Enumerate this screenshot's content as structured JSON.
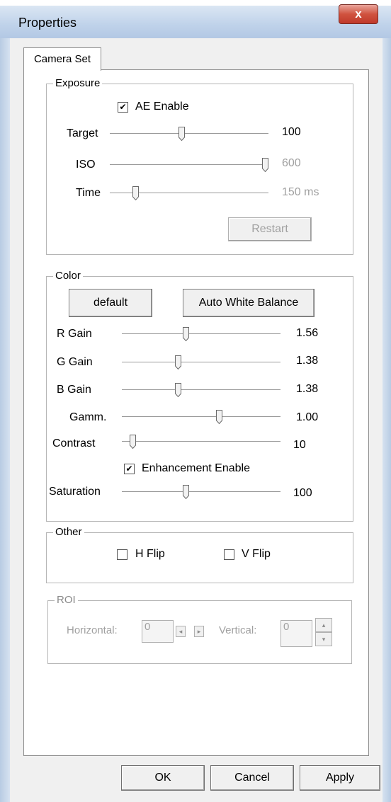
{
  "window": {
    "title": "Properties",
    "close_glyph": "x"
  },
  "tabs": [
    {
      "label": "Camera Set"
    }
  ],
  "exposure": {
    "title": "Exposure",
    "ae_enable": {
      "label": "AE Enable",
      "checked": true
    },
    "sliders": {
      "target": {
        "label": "Target",
        "value": "100",
        "level": 0.45
      },
      "iso": {
        "label": "ISO",
        "value": "600",
        "level": 1.0
      },
      "time": {
        "label": "Time",
        "value": "150 ms",
        "level": 0.15
      }
    },
    "restart_label": "Restart"
  },
  "color": {
    "title": "Color",
    "default_label": "default",
    "awb_label": "Auto White Balance",
    "sliders": {
      "r_gain": {
        "label": "R Gain",
        "value": "1.56",
        "level": 0.4
      },
      "g_gain": {
        "label": "G Gain",
        "value": "1.38",
        "level": 0.35
      },
      "b_gain": {
        "label": "B Gain",
        "value": "1.38",
        "level": 0.35
      },
      "gamma": {
        "label": "Gamm.",
        "value": "1.00",
        "level": 0.62
      },
      "contrast": {
        "label": "Contrast",
        "value": "10",
        "level": 0.05
      },
      "saturation": {
        "label": "Saturation",
        "value": "100",
        "level": 0.4
      }
    },
    "enhancement": {
      "label": "Enhancement Enable",
      "checked": true
    }
  },
  "other": {
    "title": "Other",
    "hflip": {
      "label": "H Flip",
      "checked": false
    },
    "vflip": {
      "label": "V Flip",
      "checked": false
    }
  },
  "roi": {
    "title": "ROI",
    "horizontal_label": "Horizontal:",
    "horizontal_value": "0",
    "vertical_label": "Vertical:",
    "vertical_value": "0"
  },
  "footer": {
    "ok_label": "OK",
    "cancel_label": "Cancel",
    "apply_label": "Apply"
  },
  "colors": {
    "titlebar": "#bfd2ea",
    "close": "#c0392b",
    "disabled_text": "#a0a0a0"
  }
}
